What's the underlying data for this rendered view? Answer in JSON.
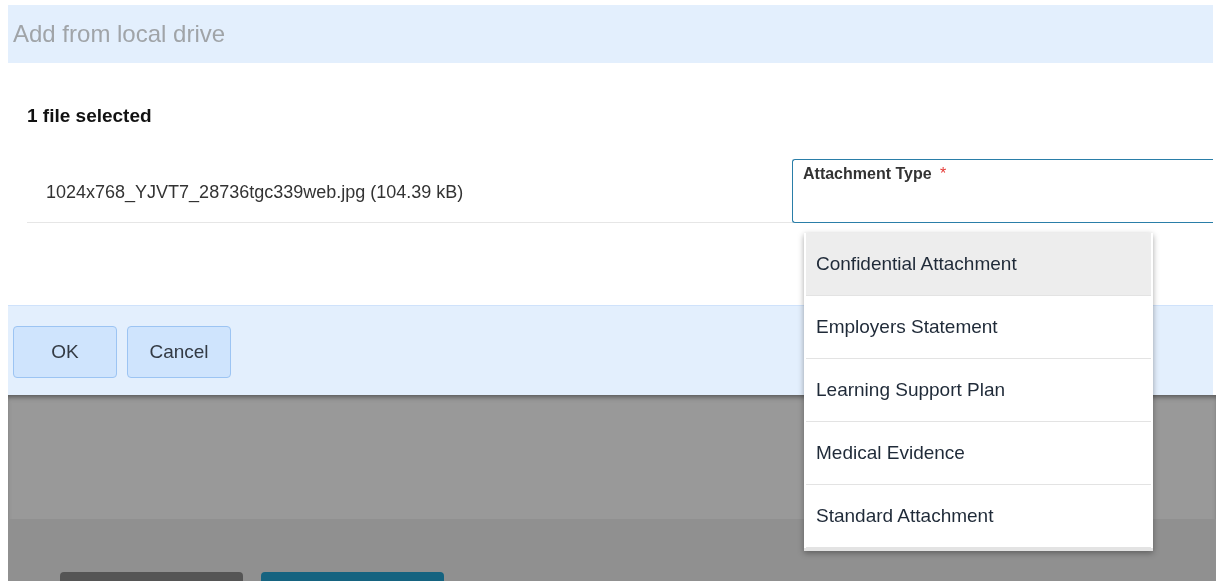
{
  "dialog": {
    "title": "Add from local drive",
    "selection_count": "1 file selected",
    "file": "1024x768_YJVT7_28736tgc339web.jpg (104.39 kB)",
    "attachment_type": {
      "label": "Attachment Type",
      "required_mark": "*",
      "expanded": true,
      "options": [
        {
          "label": "Confidential Attachment",
          "highlighted": true
        },
        {
          "label": "Employers Statement",
          "highlighted": false
        },
        {
          "label": "Learning Support Plan",
          "highlighted": false
        },
        {
          "label": "Medical Evidence",
          "highlighted": false
        },
        {
          "label": "Standard Attachment",
          "highlighted": false
        }
      ]
    },
    "buttons": [
      "OK",
      "Cancel"
    ]
  }
}
